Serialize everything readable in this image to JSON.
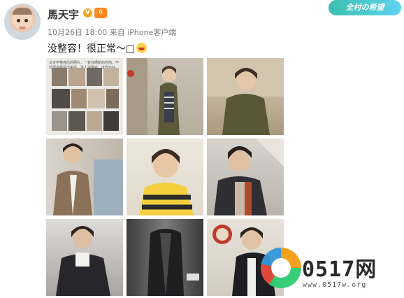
{
  "post": {
    "username": "馬天宇",
    "verified_mark": "V",
    "level_mark": "6",
    "date": "10月26日",
    "time": "18:00",
    "source": "来自 iPhone客户端",
    "text": "没整容！很正常～",
    "emoji_placeholder": "□"
  },
  "topic_tag": "全村の希望",
  "photo_1_caption": "马天宇整容后的照片，一直在晒新的自拍，不过很多都是出来后，没人说整容，这样不好。",
  "watermark": {
    "logo": "0517网",
    "url": "www.0517w.org"
  },
  "colors": {
    "accent_orange": "#f5a623",
    "tag_teal": "#3cbfae"
  }
}
